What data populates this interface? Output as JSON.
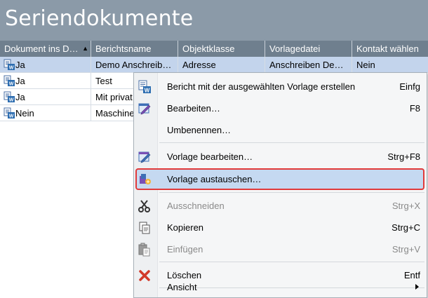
{
  "title": "Seriendokumente",
  "columns": [
    "Dokument ins D…",
    "Berichtsname",
    "Objektklasse",
    "Vorlagedatei",
    "Kontakt wählen"
  ],
  "rows": [
    {
      "doc": "Ja",
      "name": "Demo Anschreib…",
      "klasse": "Adresse",
      "vorlage": "Anschreiben De…",
      "kontakt": "Nein"
    },
    {
      "doc": "Ja",
      "name": "Test",
      "klasse": "",
      "vorlage": "",
      "kontakt": ""
    },
    {
      "doc": "Ja",
      "name": "Mit privat",
      "klasse": "",
      "vorlage": "",
      "kontakt": ""
    },
    {
      "doc": "Nein",
      "name": "Maschine",
      "klasse": "",
      "vorlage": "",
      "kontakt": ""
    }
  ],
  "menu": {
    "items": [
      {
        "label": "Bericht mit der ausgewählten Vorlage erstellen",
        "shortcut": "Einfg",
        "icon": "word-doc-icon"
      },
      {
        "label": "Bearbeiten…",
        "shortcut": "F8",
        "icon": "edit-icon"
      },
      {
        "label": "Umbenennen…",
        "shortcut": "",
        "icon": ""
      },
      {
        "label": "Vorlage bearbeiten…",
        "shortcut": "Strg+F8",
        "icon": "edit-template-icon"
      },
      {
        "label": "Vorlage austauschen…",
        "shortcut": "",
        "icon": "swap-template-icon"
      },
      {
        "label": "Ausschneiden",
        "shortcut": "Strg+X",
        "icon": "scissors-icon"
      },
      {
        "label": "Kopieren",
        "shortcut": "Strg+C",
        "icon": "copy-icon"
      },
      {
        "label": "Einfügen",
        "shortcut": "Strg+V",
        "icon": "paste-icon"
      },
      {
        "label": "Löschen",
        "shortcut": "Entf",
        "icon": "delete-icon"
      },
      {
        "label": "Ansicht",
        "shortcut": "",
        "icon": ""
      }
    ]
  },
  "colors": {
    "titlebar": "#8b9aa8",
    "header": "#6f7f8e",
    "selection": "#c3d4ec",
    "highlight_border": "#e13a3a"
  }
}
